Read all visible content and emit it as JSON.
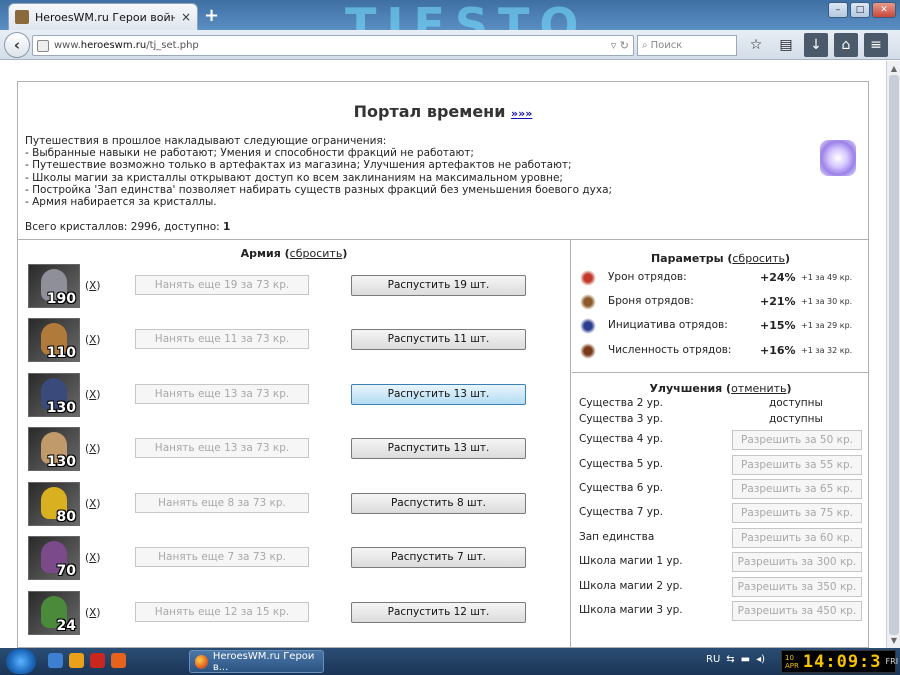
{
  "browser": {
    "tab_title": "HeroesWM.ru Герои войны и...",
    "tab_close": "×",
    "new_tab": "+",
    "url_prefix": "www.",
    "url_domain": "heroeswm.ru",
    "url_path": "/tj_set.php",
    "search_placeholder": "Поиск",
    "watermark": "TIESTO",
    "window_min": "–",
    "window_max": "□",
    "window_close": "✕",
    "icons": [
      "back-icon",
      "star-icon",
      "clipboard-icon",
      "download-icon",
      "home-icon",
      "menu-icon"
    ]
  },
  "portal": {
    "title": "Портал времени",
    "title_link": "»»»",
    "lines": [
      "Путешествия в прошлое накладывают следующие ограничения:",
      "- Выбранные навыки не работают; Умения и способности фракций не работают;",
      "- Путешествие возможно только в артефактах из магазина; Улучшения артефактов не работают;",
      "- Школы магии за кристаллы открывают доступ ко всем заклинаниям на максимальном уровне;",
      "- Постройка 'Зап единства' позволяет набирать существ разных фракций без уменьшения боевого духа;",
      "- Армия набирается за кристаллы."
    ],
    "crystals_label": "Всего кристаллов: 2996, доступно: ",
    "crystals_available": "1"
  },
  "army": {
    "title": "Армия",
    "reset_label": "сбросить",
    "units": [
      {
        "count": "190",
        "remove": "X",
        "hire": "Нанять еще 19 за 73 кр.",
        "dismiss": "Распустить 19 шт.",
        "color": "#8f8f9a"
      },
      {
        "count": "110",
        "remove": "X",
        "hire": "Нанять еще 11 за 73 кр.",
        "dismiss": "Распустить 11 шт.",
        "color": "#b07a3a"
      },
      {
        "count": "130",
        "remove": "X",
        "hire": "Нанять еще 13 за 73 кр.",
        "dismiss": "Распустить 13 шт.",
        "color": "#3a4a7a"
      },
      {
        "count": "130",
        "remove": "X",
        "hire": "Нанять еще 13 за 73 кр.",
        "dismiss": "Распустить 13 шт.",
        "color": "#c09a6a"
      },
      {
        "count": "80",
        "remove": "X",
        "hire": "Нанять еще 8 за 73 кр.",
        "dismiss": "Распустить 8 шт.",
        "color": "#d8b020"
      },
      {
        "count": "70",
        "remove": "X",
        "hire": "Нанять еще 7 за 73 кр.",
        "dismiss": "Распустить 7 шт.",
        "color": "#7a4a8a"
      },
      {
        "count": "24",
        "remove": "X",
        "hire": "Нанять еще 12 за 15 кр.",
        "dismiss": "Распустить 12 шт.",
        "color": "#4a8a3a"
      }
    ]
  },
  "params": {
    "title": "Параметры",
    "reset_label": "сбросить",
    "rows": [
      {
        "icon": "damage-icon",
        "label": "Урон отрядов:",
        "value": "+24%",
        "cost": "+1 за 49 кр."
      },
      {
        "icon": "armor-icon",
        "label": "Броня отрядов:",
        "value": "+21%",
        "cost": "+1 за 30 кр."
      },
      {
        "icon": "initiative-icon",
        "label": "Инициатива отрядов:",
        "value": "+15%",
        "cost": "+1 за 29 кр."
      },
      {
        "icon": "troop-size-icon",
        "label": "Численность отрядов:",
        "value": "+16%",
        "cost": "+1 за 32 кр."
      }
    ]
  },
  "upgrades": {
    "title": "Улучшения",
    "cancel_label": "отменить",
    "available_rows": [
      {
        "label": "Существа 2 ур.",
        "status": "доступны"
      },
      {
        "label": "Существа 3 ур.",
        "status": "доступны"
      }
    ],
    "buy_rows": [
      {
        "label": "Существа 4 ур.",
        "button": "Разрешить за 50 кр."
      },
      {
        "label": "Существа 5 ур.",
        "button": "Разрешить за 55 кр."
      },
      {
        "label": "Существа 6 ур.",
        "button": "Разрешить за 65 кр."
      },
      {
        "label": "Существа 7 ур.",
        "button": "Разрешить за 75 кр."
      },
      {
        "label": "Зап единства",
        "button": "Разрешить за 60 кр."
      },
      {
        "label": "Школа магии 1 ур.",
        "button": "Разрешить за 300 кр."
      },
      {
        "label": "Школа магии 2 ур.",
        "button": "Разрешить за 350 кр."
      },
      {
        "label": "Школа магии 3 ур.",
        "button": "Разрешить за 450 кр."
      }
    ]
  },
  "taskbar": {
    "app_label": "HeroesWM.ru Герои в...",
    "lang": "RU",
    "clock_time": "14:09:3",
    "clock_small_1": "10",
    "clock_small_2": "APR",
    "clock_day": "FRI"
  }
}
